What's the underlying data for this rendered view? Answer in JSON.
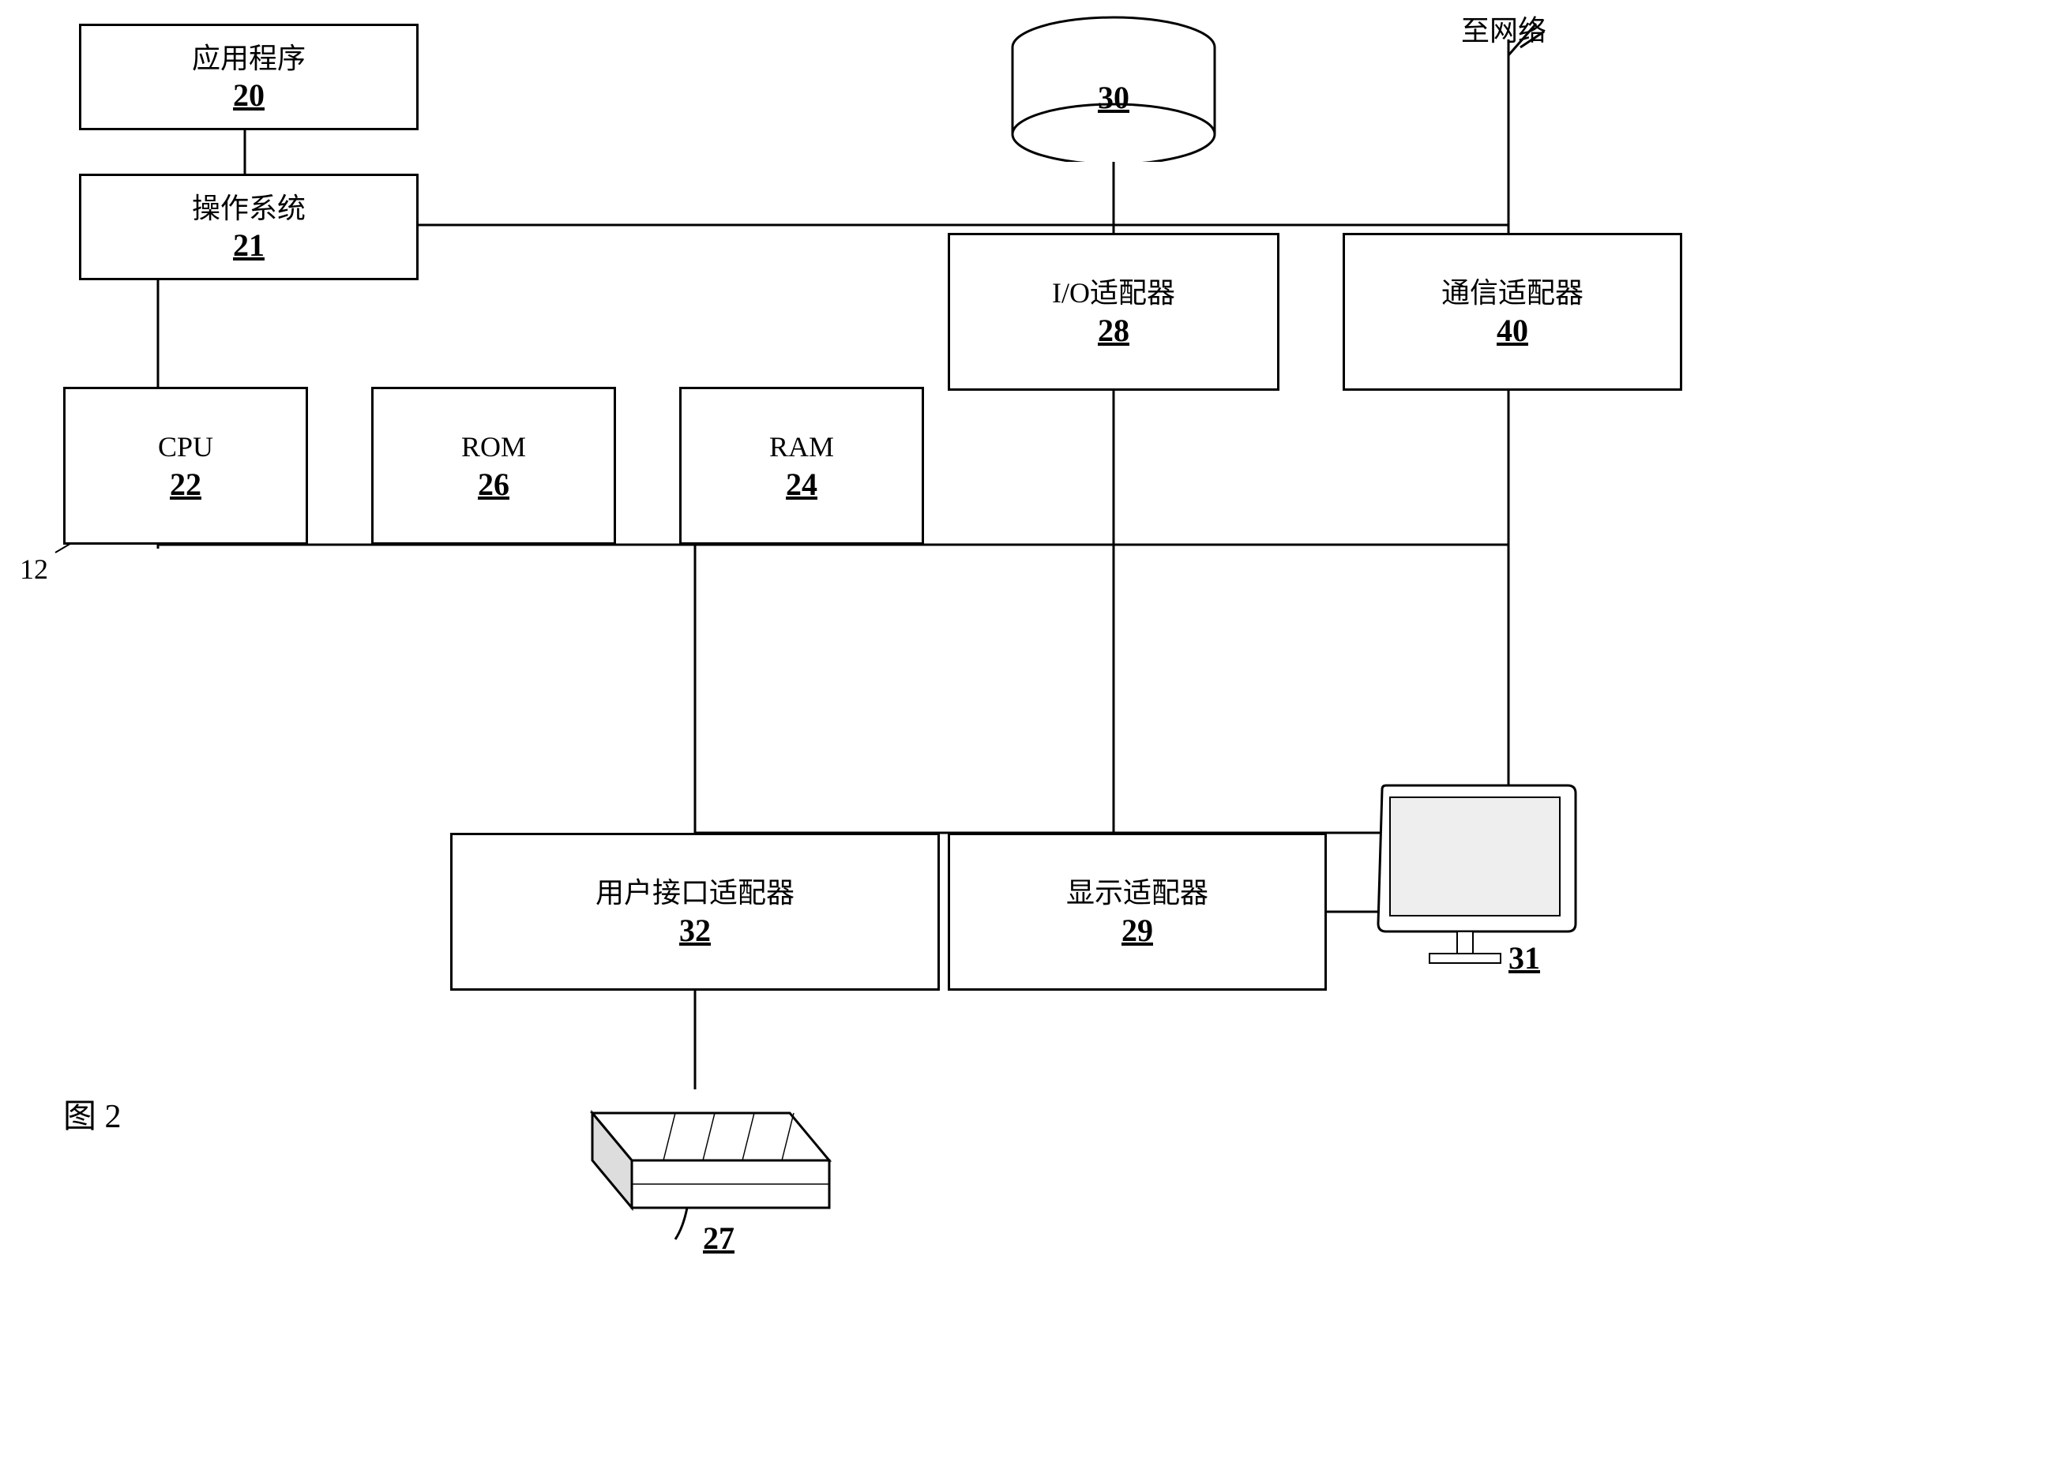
{
  "diagram": {
    "title": "图 2",
    "label_12": "12",
    "boxes": {
      "app": {
        "label": "应用程序",
        "number": "20"
      },
      "os": {
        "label": "操作系统",
        "number": "21"
      },
      "cpu": {
        "label": "CPU",
        "number": "22"
      },
      "rom": {
        "label": "ROM",
        "number": "26"
      },
      "ram": {
        "label": "RAM",
        "number": "24"
      },
      "io": {
        "label": "I/O适配器",
        "number": "28"
      },
      "comm": {
        "label": "通信适配器",
        "number": "40"
      },
      "ui": {
        "label": "用户接口适配器",
        "number": "32"
      },
      "display": {
        "label": "显示适配器",
        "number": "29"
      },
      "db": {
        "number": "30"
      },
      "monitor": {
        "number": "31"
      },
      "keyboard": {
        "number": "27"
      }
    },
    "labels": {
      "network": "至网络",
      "fig": "图  2"
    }
  }
}
